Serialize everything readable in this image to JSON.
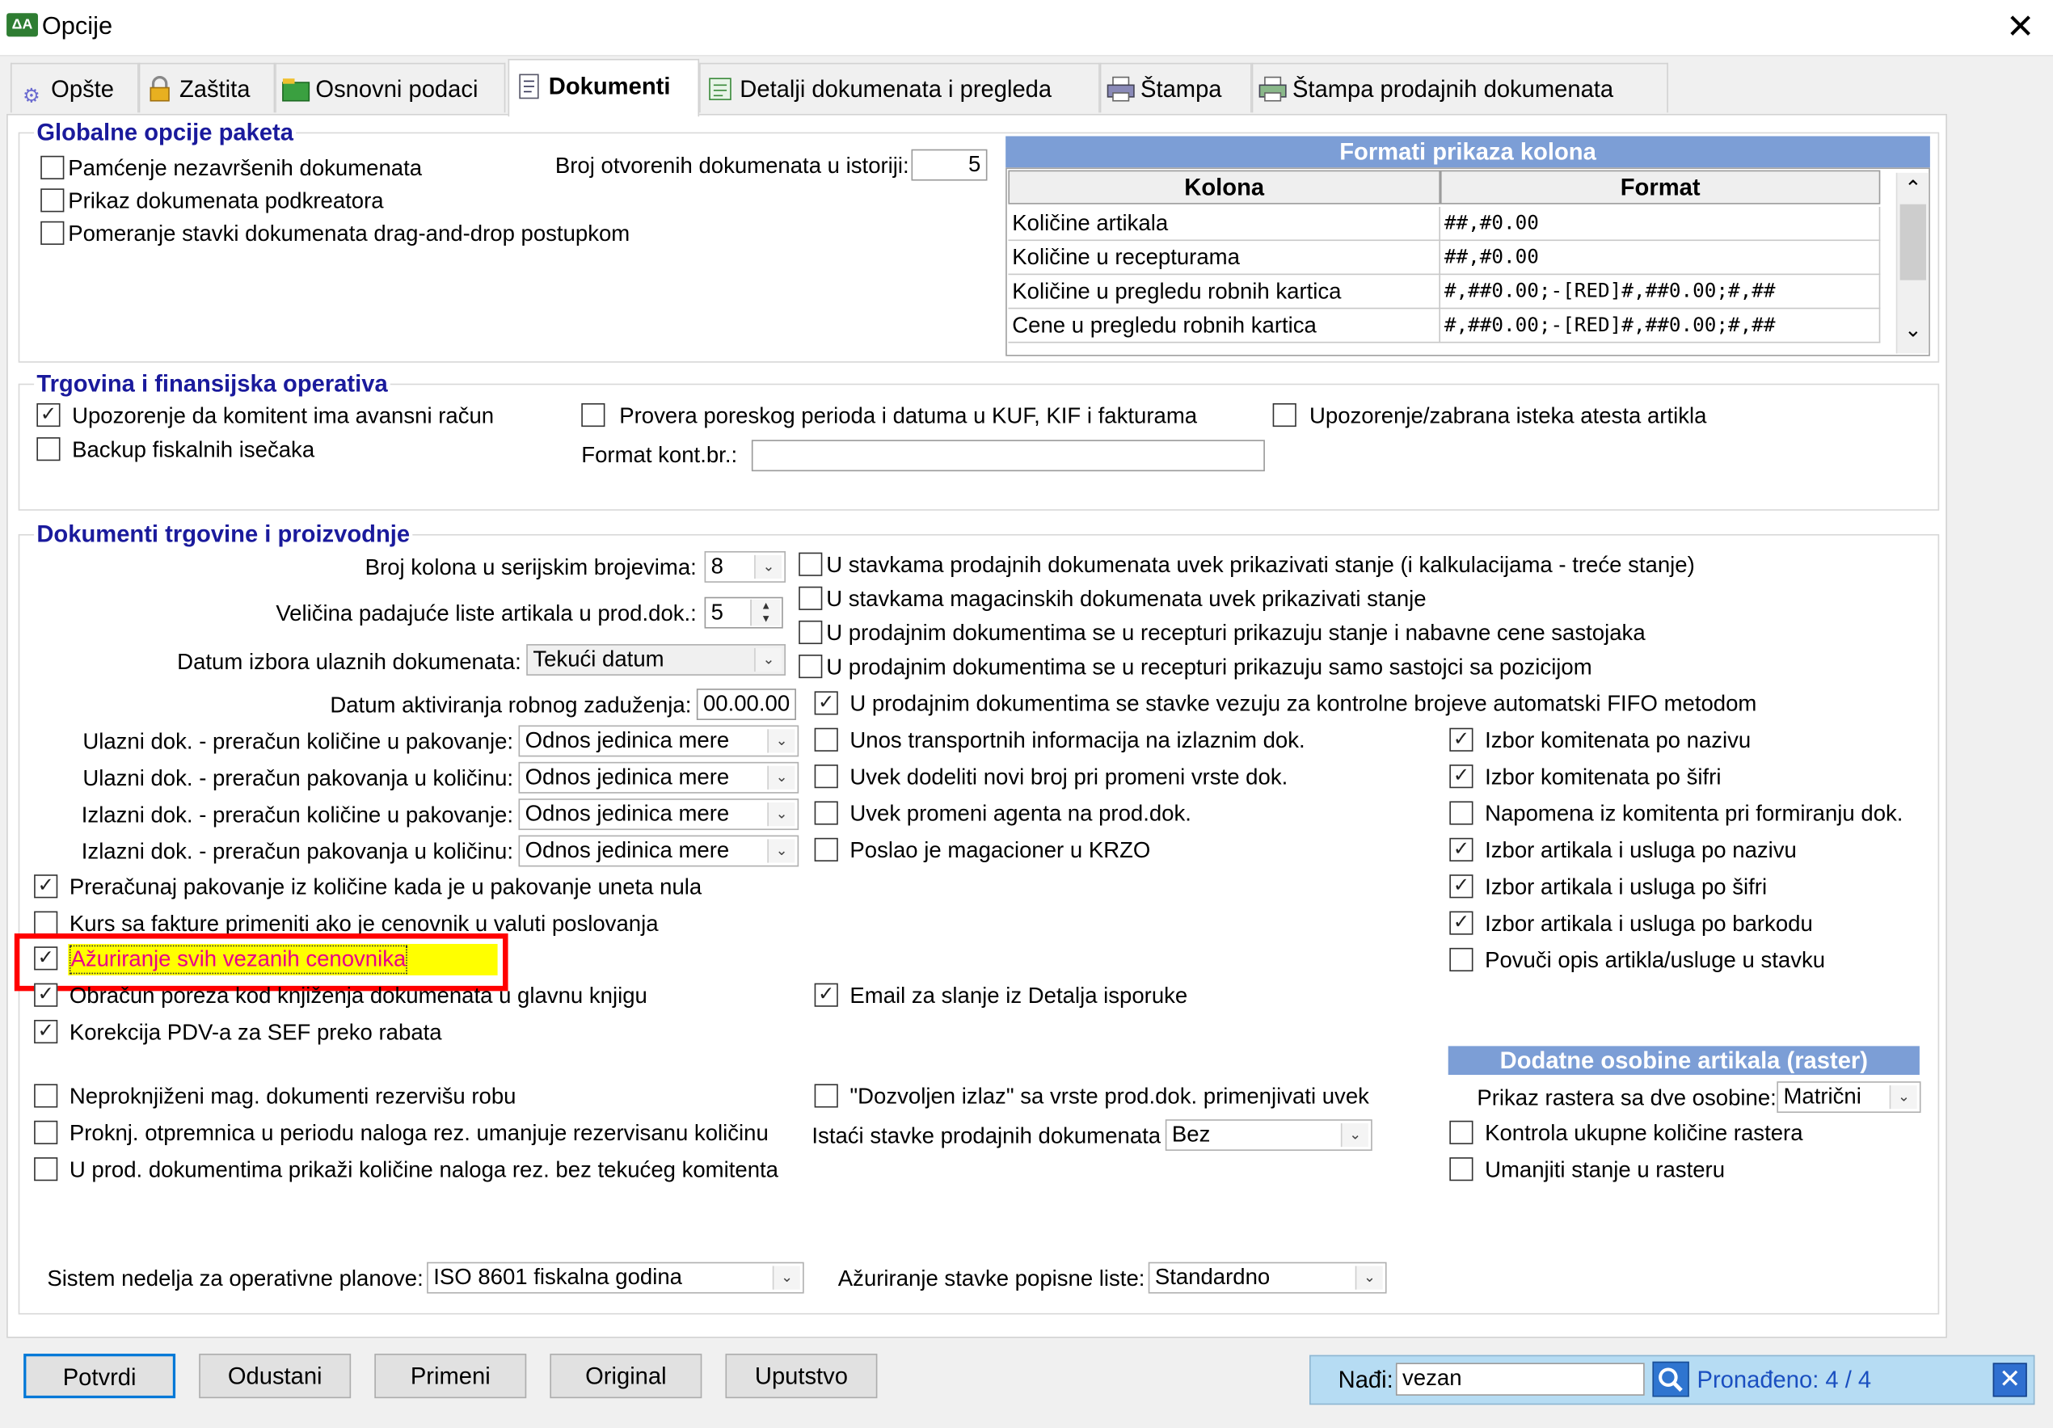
{
  "window": {
    "title": "Opcije",
    "app_icon_text": "ΔA",
    "close_glyph": "✕"
  },
  "tabs": [
    {
      "label": "Opšte",
      "icon": "gear-icon"
    },
    {
      "label": "Zaštita",
      "icon": "lock-icon"
    },
    {
      "label": "Osnovni podaci",
      "icon": "folder-icon"
    },
    {
      "label": "Dokumenti",
      "icon": "document-icon",
      "active": true
    },
    {
      "label": "Detalji dokumenata i pregleda",
      "icon": "list-icon"
    },
    {
      "label": "Štampa",
      "icon": "printer-icon"
    },
    {
      "label": "Štampa prodajnih dokumenata",
      "icon": "printer-icon"
    }
  ],
  "global": {
    "title": "Globalne opcije paketa",
    "cb_pamcenje": "Pamćenje nezavršenih dokumenata",
    "cb_prikaz": "Prikaz dokumenata podkreatora",
    "cb_pomeranje": "Pomeranje stavki dokumenata drag-and-drop postupkom",
    "broj_label": "Broj otvorenih dokumenata u istoriji:",
    "broj_value": "5"
  },
  "formats": {
    "title": "Formati prikaza kolona",
    "col_kolona": "Kolona",
    "col_format": "Format",
    "rows": [
      {
        "kolona": "Količine artikala",
        "format": "##,#0.00"
      },
      {
        "kolona": "Količine u recepturama",
        "format": "##,#0.00"
      },
      {
        "kolona": "Količine u pregledu robnih kartica",
        "format": "#,##0.00;-[RED]#,##0.00;#,##"
      },
      {
        "kolona": "Cene u pregledu robnih kartica",
        "format": "#,##0.00;-[RED]#,##0.00;#,##"
      }
    ],
    "scroll_up": "⌃",
    "scroll_down": "⌄"
  },
  "trgovina": {
    "title": "Trgovina i finansijska operativa",
    "cb_upozorenje": "Upozorenje da komitent ima avansni račun",
    "cb_backup": "Backup fiskalnih isečaka",
    "cb_provera": "Provera poreskog perioda i datuma u KUF, KIF i fakturama",
    "cb_atest": "Upozorenje/zabrana isteka atesta artikla",
    "format_label": "Format kont.br.:",
    "format_value": ""
  },
  "dok": {
    "title": "Dokumenti trgovine i proizvodnje",
    "broj_kolona_label": "Broj kolona u serijskim brojevima:",
    "broj_kolona_value": "8",
    "velicina_label": "Veličina padajuće liste artikala u prod.dok.:",
    "velicina_value": "5",
    "datum_izbora_label": "Datum izbora ulaznih dokumenata:",
    "datum_izbora_value": "Tekući datum",
    "datum_akt_label": "Datum aktiviranja robnog zaduženja:",
    "datum_akt_value": "00.00.00",
    "ulazni1_label": "Ulazni dok. - preračun količine u pakovanje:",
    "ulazni2_label": "Ulazni dok. - preračun pakovanja u količinu:",
    "izlazni1_label": "Izlazni dok. - preračun količine u pakovanje:",
    "izlazni2_label": "Izlazni dok. - preračun pakovanja u količinu:",
    "odnos_value": "Odnos jedinica mere",
    "cb_preracunaj": "Preračunaj pakovanje iz količine kada je u pakovanje uneta nula",
    "cb_kurs": "Kurs sa fakture primeniti ako je cenovnik u valuti poslovanja",
    "cb_azuriranje": "Ažuriranje svih vezanih cenovnika",
    "cb_obracun": "Obračun poreza kod knjiženja dokumenata u glavnu knjigu",
    "cb_korekcija": "Korekcija PDV-a za SEF preko rabata",
    "cb_neproknj": "Neproknjiženi mag. dokumenti rezervišu robu",
    "cb_proknj": "Proknj. otpremnica u periodu naloga rez. umanjuje rezervisanu količinu",
    "cb_uprod": "U prod. dokumentima prikaži količine naloga rez. bez tekućeg komitenta",
    "cb_m1": "U stavkama prodajnih dokumenata uvek prikazivati stanje (i kalkulacijama - treće stanje)",
    "cb_m2": "U stavkama magacinskih dokumenata uvek prikazivati stanje",
    "cb_m3": "U prodajnim dokumentima se u recepturi prikazuju stanje i nabavne cene sastojaka",
    "cb_m4": "U prodajnim dokumentima se u recepturi prikazuju samo sastojci sa pozicijom",
    "cb_m5": "U prodajnim dokumentima se stavke vezuju za kontrolne brojeve automatski FIFO metodom",
    "cb_unos": "Unos transportnih informacija na izlaznim dok.",
    "cb_uvek_broj": "Uvek dodeliti novi broj pri promeni vrste dok.",
    "cb_uvek_agent": "Uvek promeni agenta na prod.dok.",
    "cb_poslao": "Poslao je magacioner u KRZO",
    "cb_email": "Email za slanje iz Detalja isporuke",
    "cb_dozvoljen": "\"Dozvoljen izlaz\" sa vrste prod.dok. primenjivati uvek",
    "istaci_label": "Istaći stavke prodajnih dokumenata",
    "istaci_value": "Bez",
    "cb_r1": "Izbor komitenata po nazivu",
    "cb_r2": "Izbor komitenata po šifri",
    "cb_r3": "Napomena iz komitenta pri formiranju dok.",
    "cb_r4": "Izbor artikala i usluga po nazivu",
    "cb_r5": "Izbor artikala i usluga po šifri",
    "cb_r6": "Izbor artikala i usluga po barkodu",
    "cb_r7": "Povuči opis artikla/usluge u stavku",
    "raster_title": "Dodatne osobine artikala (raster)",
    "raster_label": "Prikaz rastera sa dve osobine:",
    "raster_value": "Matrični",
    "cb_kontrola": "Kontrola ukupne količine rastera",
    "cb_umanjiti": "Umanjiti stanje u rasteru",
    "sistem_label": "Sistem nedelja za operativne planove:",
    "sistem_value": "ISO 8601 fiskalna godina",
    "azur_popis_label": "Ažuriranje stavke popisne liste:",
    "azur_popis_value": "Standardno"
  },
  "buttons": {
    "potvrdi": "Potvrdi",
    "odustani": "Odustani",
    "primeni": "Primeni",
    "original": "Original",
    "uputstvo": "Uputstvo"
  },
  "find": {
    "label": "Nađi:",
    "value": "vezan",
    "result": "Pronađeno: 4 / 4",
    "close_glyph": "✕"
  },
  "glyphs": {
    "check": "✓",
    "dropdown": "⌄",
    "spin_up": "▲",
    "spin_down": "▼"
  },
  "colors": {
    "accent": "#7c9ed6",
    "group_title": "#1a1a9c",
    "highlight": "#ffff00",
    "highlight_text": "#e8008a",
    "marker": "#ff0000"
  }
}
